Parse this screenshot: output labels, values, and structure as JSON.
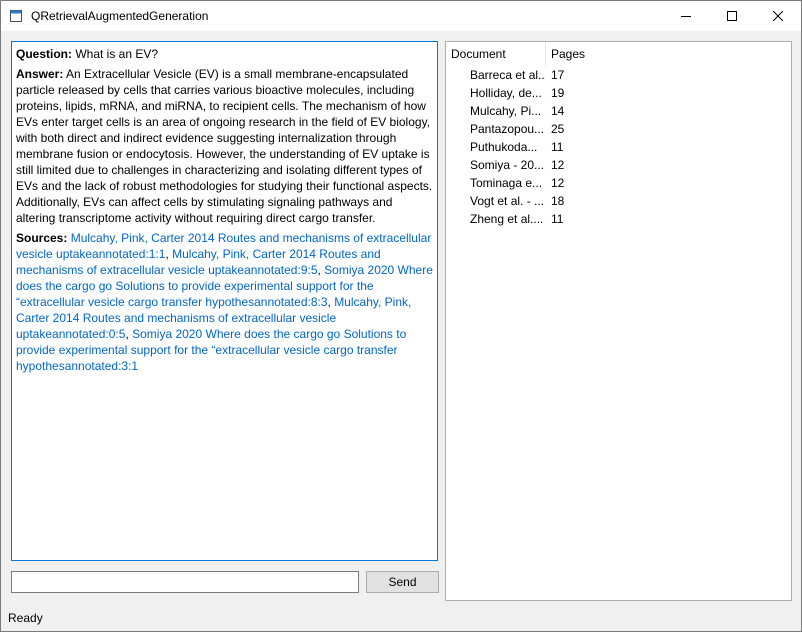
{
  "window": {
    "title": "QRetrievalAugmentedGeneration",
    "icon": "app-window-icon",
    "controls": {
      "minimize": "minimize-icon",
      "maximize": "maximize-icon",
      "close": "close-icon"
    }
  },
  "chat": {
    "question_label": "Question:",
    "question_text": " What is an EV?",
    "answer_label": "Answer:",
    "answer_text": "  An Extracellular Vesicle (EV) is a small membrane-encapsulated particle released by cells that carries various bioactive molecules, including proteins, lipids, mRNA, and miRNA, to recipient cells. The mechanism of how EVs enter target cells is an area of ongoing research in the field of EV biology, with both direct and indirect evidence suggesting internalization through membrane fusion or endocytosis. However, the understanding of EV uptake is still limited due to challenges in characterizing and isolating different types of EVs and the lack of robust methodologies for studying their functional aspects. Additionally, EVs can affect cells by stimulating signaling pathways and altering transcriptome activity without requiring direct cargo transfer.",
    "sources_label": "Sources:",
    "sources": [
      "Mulcahy, Pink, Carter  2014  Routes and mechanisms of extracellular vesicle uptakeannotated:1:1",
      "Mulcahy, Pink, Carter  2014  Routes and mechanisms of extracellular vesicle uptakeannotated:9:5",
      "Somiya  2020  Where does the cargo go Solutions to provide experimental support for the “extracellular vesicle cargo transfer hypothesannotated:8:3",
      "Mulcahy, Pink, Carter  2014  Routes and mechanisms of extracellular vesicle uptakeannotated:0:5",
      "Somiya  2020  Where does the cargo go Solutions to provide experimental support for the “extracellular vesicle cargo transfer hypothesannotated:3:1"
    ],
    "separator": ", "
  },
  "documents": {
    "headers": {
      "document": "Document",
      "pages": "Pages"
    },
    "rows": [
      {
        "document": "Barreca et al...",
        "pages": "17"
      },
      {
        "document": "Holliday, de...",
        "pages": "19"
      },
      {
        "document": "Mulcahy, Pi...",
        "pages": "14"
      },
      {
        "document": "Pantazopou...",
        "pages": "25"
      },
      {
        "document": "Puthukoda...",
        "pages": "11"
      },
      {
        "document": "Somiya - 20...",
        "pages": "12"
      },
      {
        "document": "Tominaga e...",
        "pages": "12"
      },
      {
        "document": "Vogt et al. - ...",
        "pages": "18"
      },
      {
        "document": "Zheng et al....",
        "pages": "11"
      }
    ]
  },
  "input": {
    "value": "",
    "placeholder": ""
  },
  "send_button": {
    "label": "Send"
  },
  "status": {
    "text": "Ready"
  },
  "colors": {
    "accent": "#0078d7",
    "link": "#0066cc",
    "window_bg": "#f0f0f0"
  }
}
